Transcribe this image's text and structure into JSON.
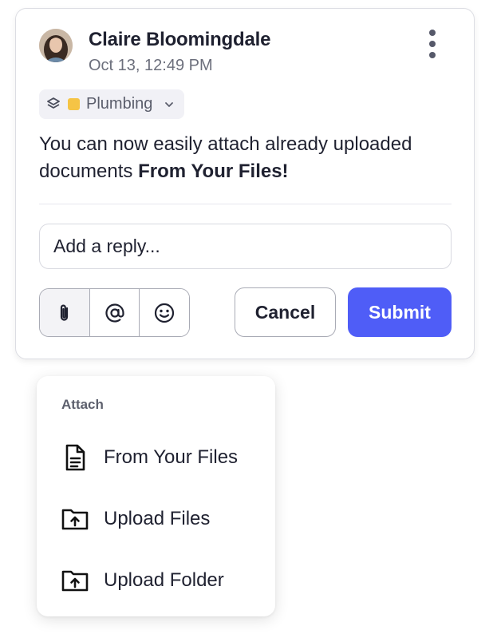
{
  "comment": {
    "author": "Claire Bloomingdale",
    "timestamp": "Oct 13, 12:49 PM",
    "tag": {
      "label": "Plumbing",
      "color": "#f5c445"
    },
    "message_text": "You can now easily attach already uploaded documents ",
    "message_bold": "From Your Files!"
  },
  "reply": {
    "placeholder": "Add a reply..."
  },
  "toolbar": {
    "tools": [
      {
        "name": "attach",
        "icon": "paperclip-icon"
      },
      {
        "name": "mention",
        "icon": "at-icon"
      },
      {
        "name": "emoji",
        "icon": "smiley-icon"
      }
    ],
    "cancel_label": "Cancel",
    "submit_label": "Submit",
    "submit_color": "#4f5df7"
  },
  "attach_menu": {
    "title": "Attach",
    "items": [
      {
        "label": "From Your Files",
        "icon": "document-icon"
      },
      {
        "label": "Upload Files",
        "icon": "folder-upload-icon"
      },
      {
        "label": "Upload Folder",
        "icon": "folder-upload-icon"
      }
    ]
  }
}
